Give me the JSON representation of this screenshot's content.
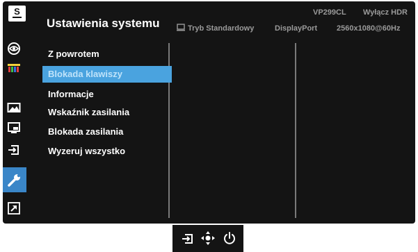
{
  "header": {
    "logo_letter": "S",
    "title": "Ustawienia systemu",
    "model": "VP299CL",
    "hdr_status": "Wyłącz HDR",
    "mode": "Tryb Standardowy",
    "input": "DisplayPort",
    "resolution": "2560x1080@60Hz"
  },
  "sidebar": {
    "items": [
      {
        "icon": "eye-care-icon",
        "active": false
      },
      {
        "icon": "color-icon",
        "active": false
      },
      {
        "icon": "image-icon",
        "active": false
      },
      {
        "icon": "pip-icon",
        "active": false
      },
      {
        "icon": "input-select-icon",
        "active": false
      },
      {
        "icon": "wrench-icon",
        "active": true
      },
      {
        "icon": "shortcut-icon",
        "active": false
      }
    ]
  },
  "submenu": {
    "items": [
      {
        "label": "Z powrotem",
        "selected": false
      },
      {
        "label": "Blokada klawiszy",
        "selected": true
      },
      {
        "label": "Informacje",
        "selected": false
      },
      {
        "label": "Wskaźnik zasilania",
        "selected": false
      },
      {
        "label": "Blokada zasilania",
        "selected": false
      },
      {
        "label": "Wyzeruj wszystko",
        "selected": false
      }
    ]
  },
  "keys": {
    "items": [
      "input-select-icon",
      "five-way-navigation-icon",
      "power-icon"
    ]
  },
  "colors": {
    "background": "#141414",
    "active_nav": "#3a86c8",
    "selected_item": "#4aa3df",
    "dim_text": "#9a9a9a"
  }
}
